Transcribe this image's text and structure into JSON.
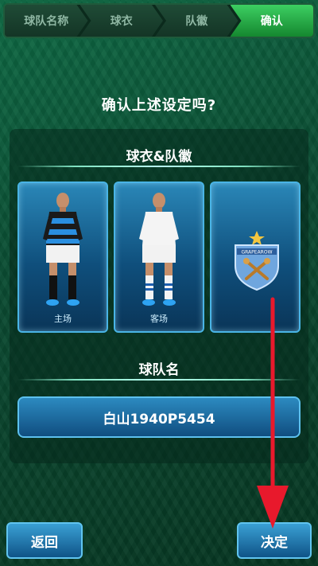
{
  "steps": [
    "球队名称",
    "球衣",
    "队徽",
    "确认"
  ],
  "active_step": 3,
  "title": "确认上述设定吗?",
  "jersey_section": {
    "title": "球衣&队徽",
    "cards": [
      {
        "label": "主场",
        "icon": "home-kit-player-icon"
      },
      {
        "label": "客场",
        "icon": "away-kit-player-icon"
      },
      {
        "label": "",
        "icon": "team-badge-icon"
      }
    ]
  },
  "team_section": {
    "title": "球队名",
    "team_name": "白山1940P5454"
  },
  "buttons": {
    "back": "返回",
    "confirm": "决定"
  },
  "badge_text": "GRAPEAROW",
  "colors": {
    "accent_green": "#2fbf55",
    "card_blue": "#1f6fa3",
    "arrow_red": "#e8192c"
  }
}
